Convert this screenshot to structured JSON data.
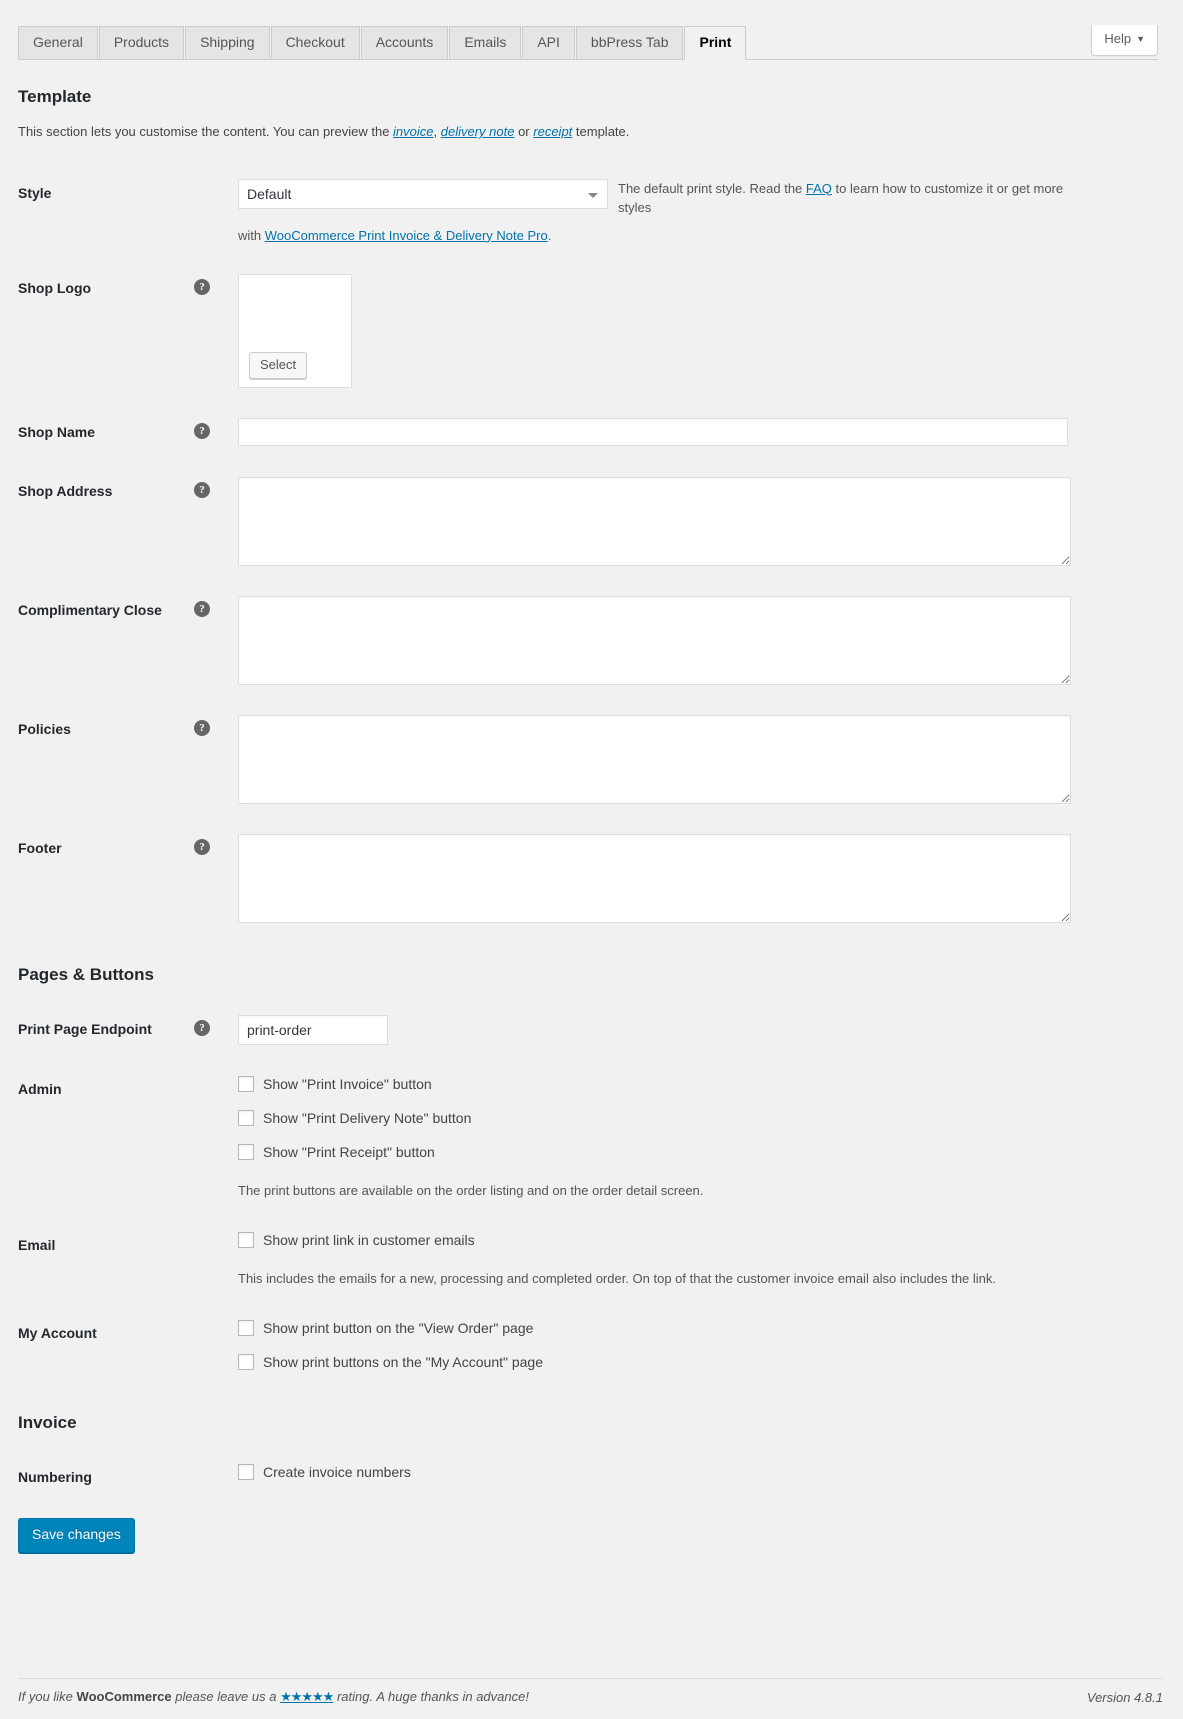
{
  "help": {
    "label": "Help",
    "caret": "▼"
  },
  "tabs": [
    {
      "label": "General",
      "active": false
    },
    {
      "label": "Products",
      "active": false
    },
    {
      "label": "Shipping",
      "active": false
    },
    {
      "label": "Checkout",
      "active": false
    },
    {
      "label": "Accounts",
      "active": false
    },
    {
      "label": "Emails",
      "active": false
    },
    {
      "label": "API",
      "active": false
    },
    {
      "label": "bbPress Tab",
      "active": false
    },
    {
      "label": "Print",
      "active": true
    }
  ],
  "template_section": {
    "title": "Template",
    "desc_part1": "This section lets you customise the content. You can preview the ",
    "link_invoice": "invoice",
    "desc_sep1": ", ",
    "link_delivery_note": "delivery note",
    "desc_sep2": " or ",
    "link_receipt": "receipt",
    "desc_part2": " template."
  },
  "style": {
    "label": "Style",
    "value": "Default",
    "options": [
      "Default"
    ],
    "desc_before_link": "The default print style. Read the ",
    "faq_link": "FAQ",
    "desc_after_link": " to learn how to customize it or get more styles",
    "sub_before_link": "with ",
    "sub_link": "WooCommerce Print Invoice & Delivery Note Pro",
    "sub_after_link": "."
  },
  "shop_logo": {
    "label": "Shop Logo",
    "select_button": "Select",
    "tip": "?"
  },
  "shop_name": {
    "label": "Shop Name",
    "value": "",
    "tip": "?"
  },
  "shop_address": {
    "label": "Shop Address",
    "value": "",
    "tip": "?"
  },
  "complimentary_close": {
    "label": "Complimentary Close",
    "value": "",
    "tip": "?"
  },
  "policies": {
    "label": "Policies",
    "value": "",
    "tip": "?"
  },
  "footer_field": {
    "label": "Footer",
    "value": "",
    "tip": "?"
  },
  "pages_buttons_section": {
    "title": "Pages & Buttons"
  },
  "print_page_endpoint": {
    "label": "Print Page Endpoint",
    "value": "print-order",
    "tip": "?"
  },
  "admin": {
    "label": "Admin",
    "checkboxes": [
      {
        "label": "Show \"Print Invoice\" button",
        "checked": false
      },
      {
        "label": "Show \"Print Delivery Note\" button",
        "checked": false
      },
      {
        "label": "Show \"Print Receipt\" button",
        "checked": false
      }
    ],
    "desc": "The print buttons are available on the order listing and on the order detail screen."
  },
  "email": {
    "label": "Email",
    "checkboxes": [
      {
        "label": "Show print link in customer emails",
        "checked": false
      }
    ],
    "desc": "This includes the emails for a new, processing and completed order. On top of that the customer invoice email also includes the link."
  },
  "my_account": {
    "label": "My Account",
    "checkboxes": [
      {
        "label": "Show print button on the \"View Order\" page",
        "checked": false
      },
      {
        "label": "Show print buttons on the \"My Account\" page",
        "checked": false
      }
    ]
  },
  "invoice_section": {
    "title": "Invoice"
  },
  "numbering": {
    "label": "Numbering",
    "checkboxes": [
      {
        "label": "Create invoice numbers",
        "checked": false
      }
    ]
  },
  "submit": {
    "save_label": "Save changes"
  },
  "page_footer": {
    "text_before": "If you like ",
    "brand": "WooCommerce",
    "text_middle": " please leave us a ",
    "stars": "★★★★★",
    "text_after": " rating. A huge thanks in advance!",
    "version": "Version 4.8.1"
  },
  "colors": {
    "page_bg": "#f1f1f1",
    "accent": "#0073aa",
    "primary_button": "#0085ba",
    "tab_inactive": "#e5e5e5",
    "border": "#ccc"
  }
}
